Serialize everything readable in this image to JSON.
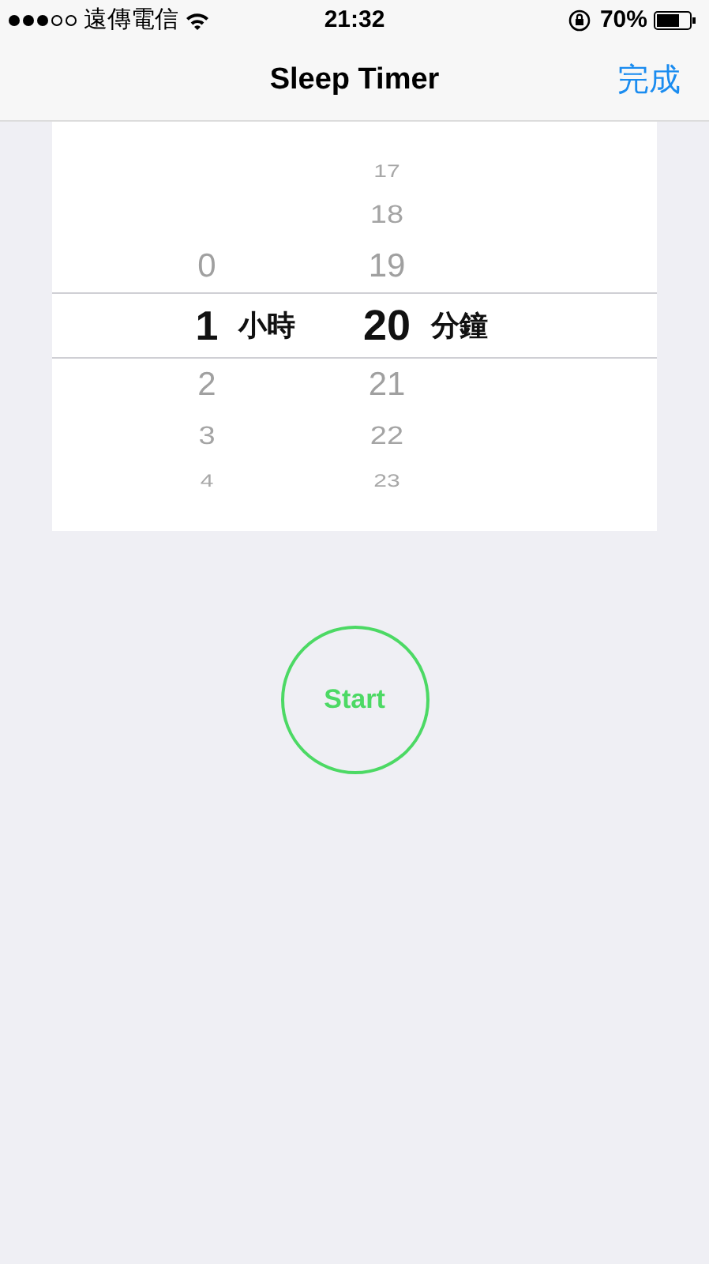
{
  "status_bar": {
    "carrier": "遠傳電信",
    "time": "21:32",
    "battery": "70%"
  },
  "nav": {
    "title": "Sleep Timer",
    "done": "完成"
  },
  "picker": {
    "columns": [
      {
        "above": [
          "0"
        ],
        "value": "1",
        "unit": "小時",
        "below": [
          "2",
          "3",
          "4"
        ]
      },
      {
        "above": [
          "17",
          "18",
          "19"
        ],
        "value": "20",
        "unit": "分鐘",
        "below": [
          "21",
          "22",
          "23"
        ]
      }
    ]
  },
  "start_button": {
    "label": "Start"
  }
}
